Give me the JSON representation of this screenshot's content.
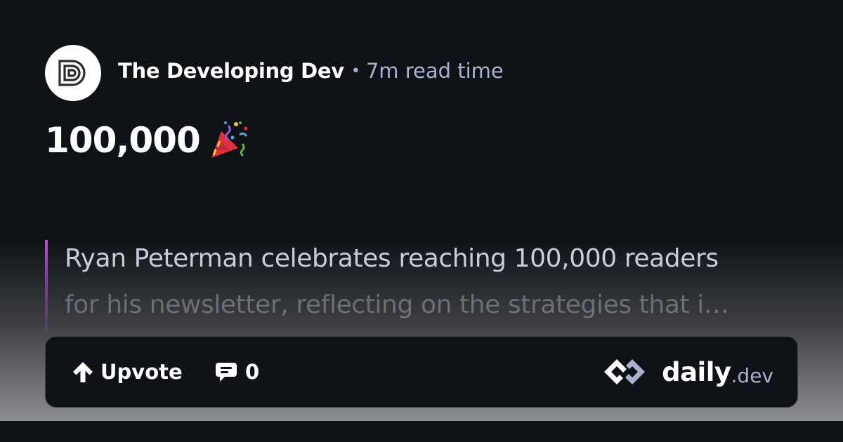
{
  "post": {
    "source_name": "The Developing Dev",
    "separator": "•",
    "read_time": "7m read time",
    "title": "100,000",
    "title_emoji": "party-popper-icon",
    "tldr_line1": "Ryan Peterman celebrates reaching 100,000 readers",
    "tldr_line2": "for his newsletter, reflecting on the strategies that i…"
  },
  "actions": {
    "upvote_label": "Upvote",
    "comment_count": "0"
  },
  "brand": {
    "name": "daily",
    "suffix": ".dev"
  },
  "colors": {
    "background": "#0e1217",
    "text_primary": "#ffffff",
    "text_secondary": "#a8b3cf",
    "tldr_accent": "#b84de0",
    "border": "#3c4049"
  }
}
